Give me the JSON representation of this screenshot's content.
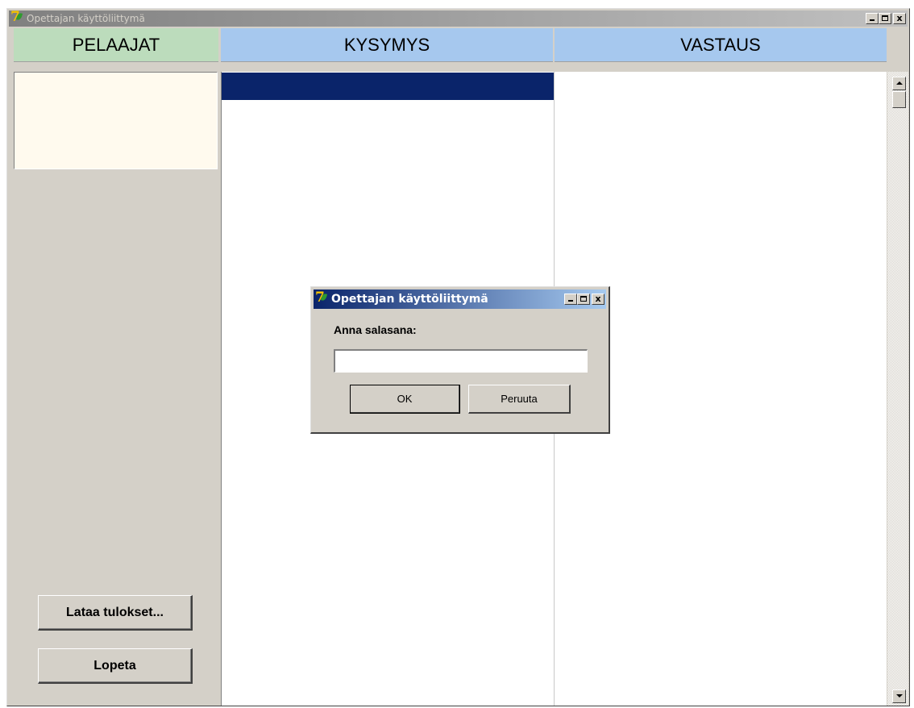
{
  "window": {
    "title": "Opettajan käyttöliittymä",
    "minimize_glyph": "_",
    "close_glyph": "x"
  },
  "columns": {
    "players": "PELAAJAT",
    "question": "KYSYMYS",
    "answer": "VASTAUS"
  },
  "buttons": {
    "load_results": "Lataa tulokset...",
    "quit": "Lopeta"
  },
  "dialog": {
    "title": "Opettajan käyttöliittymä",
    "prompt": "Anna salasana:",
    "password_value": "",
    "ok_label": "OK",
    "cancel_label": "Peruuta"
  },
  "colors": {
    "players_header": "#bcdcbc",
    "table_header": "#a6c8ee",
    "selection": "#0a246a",
    "players_list_bg": "#fffaee",
    "active_title": "#0a246a"
  },
  "icons": {
    "app": "app-icon-7-leaf",
    "minimize": "minimize-icon",
    "maximize": "maximize-icon",
    "close": "close-icon",
    "scroll_up": "arrow-up-icon",
    "scroll_down": "arrow-down-icon"
  }
}
